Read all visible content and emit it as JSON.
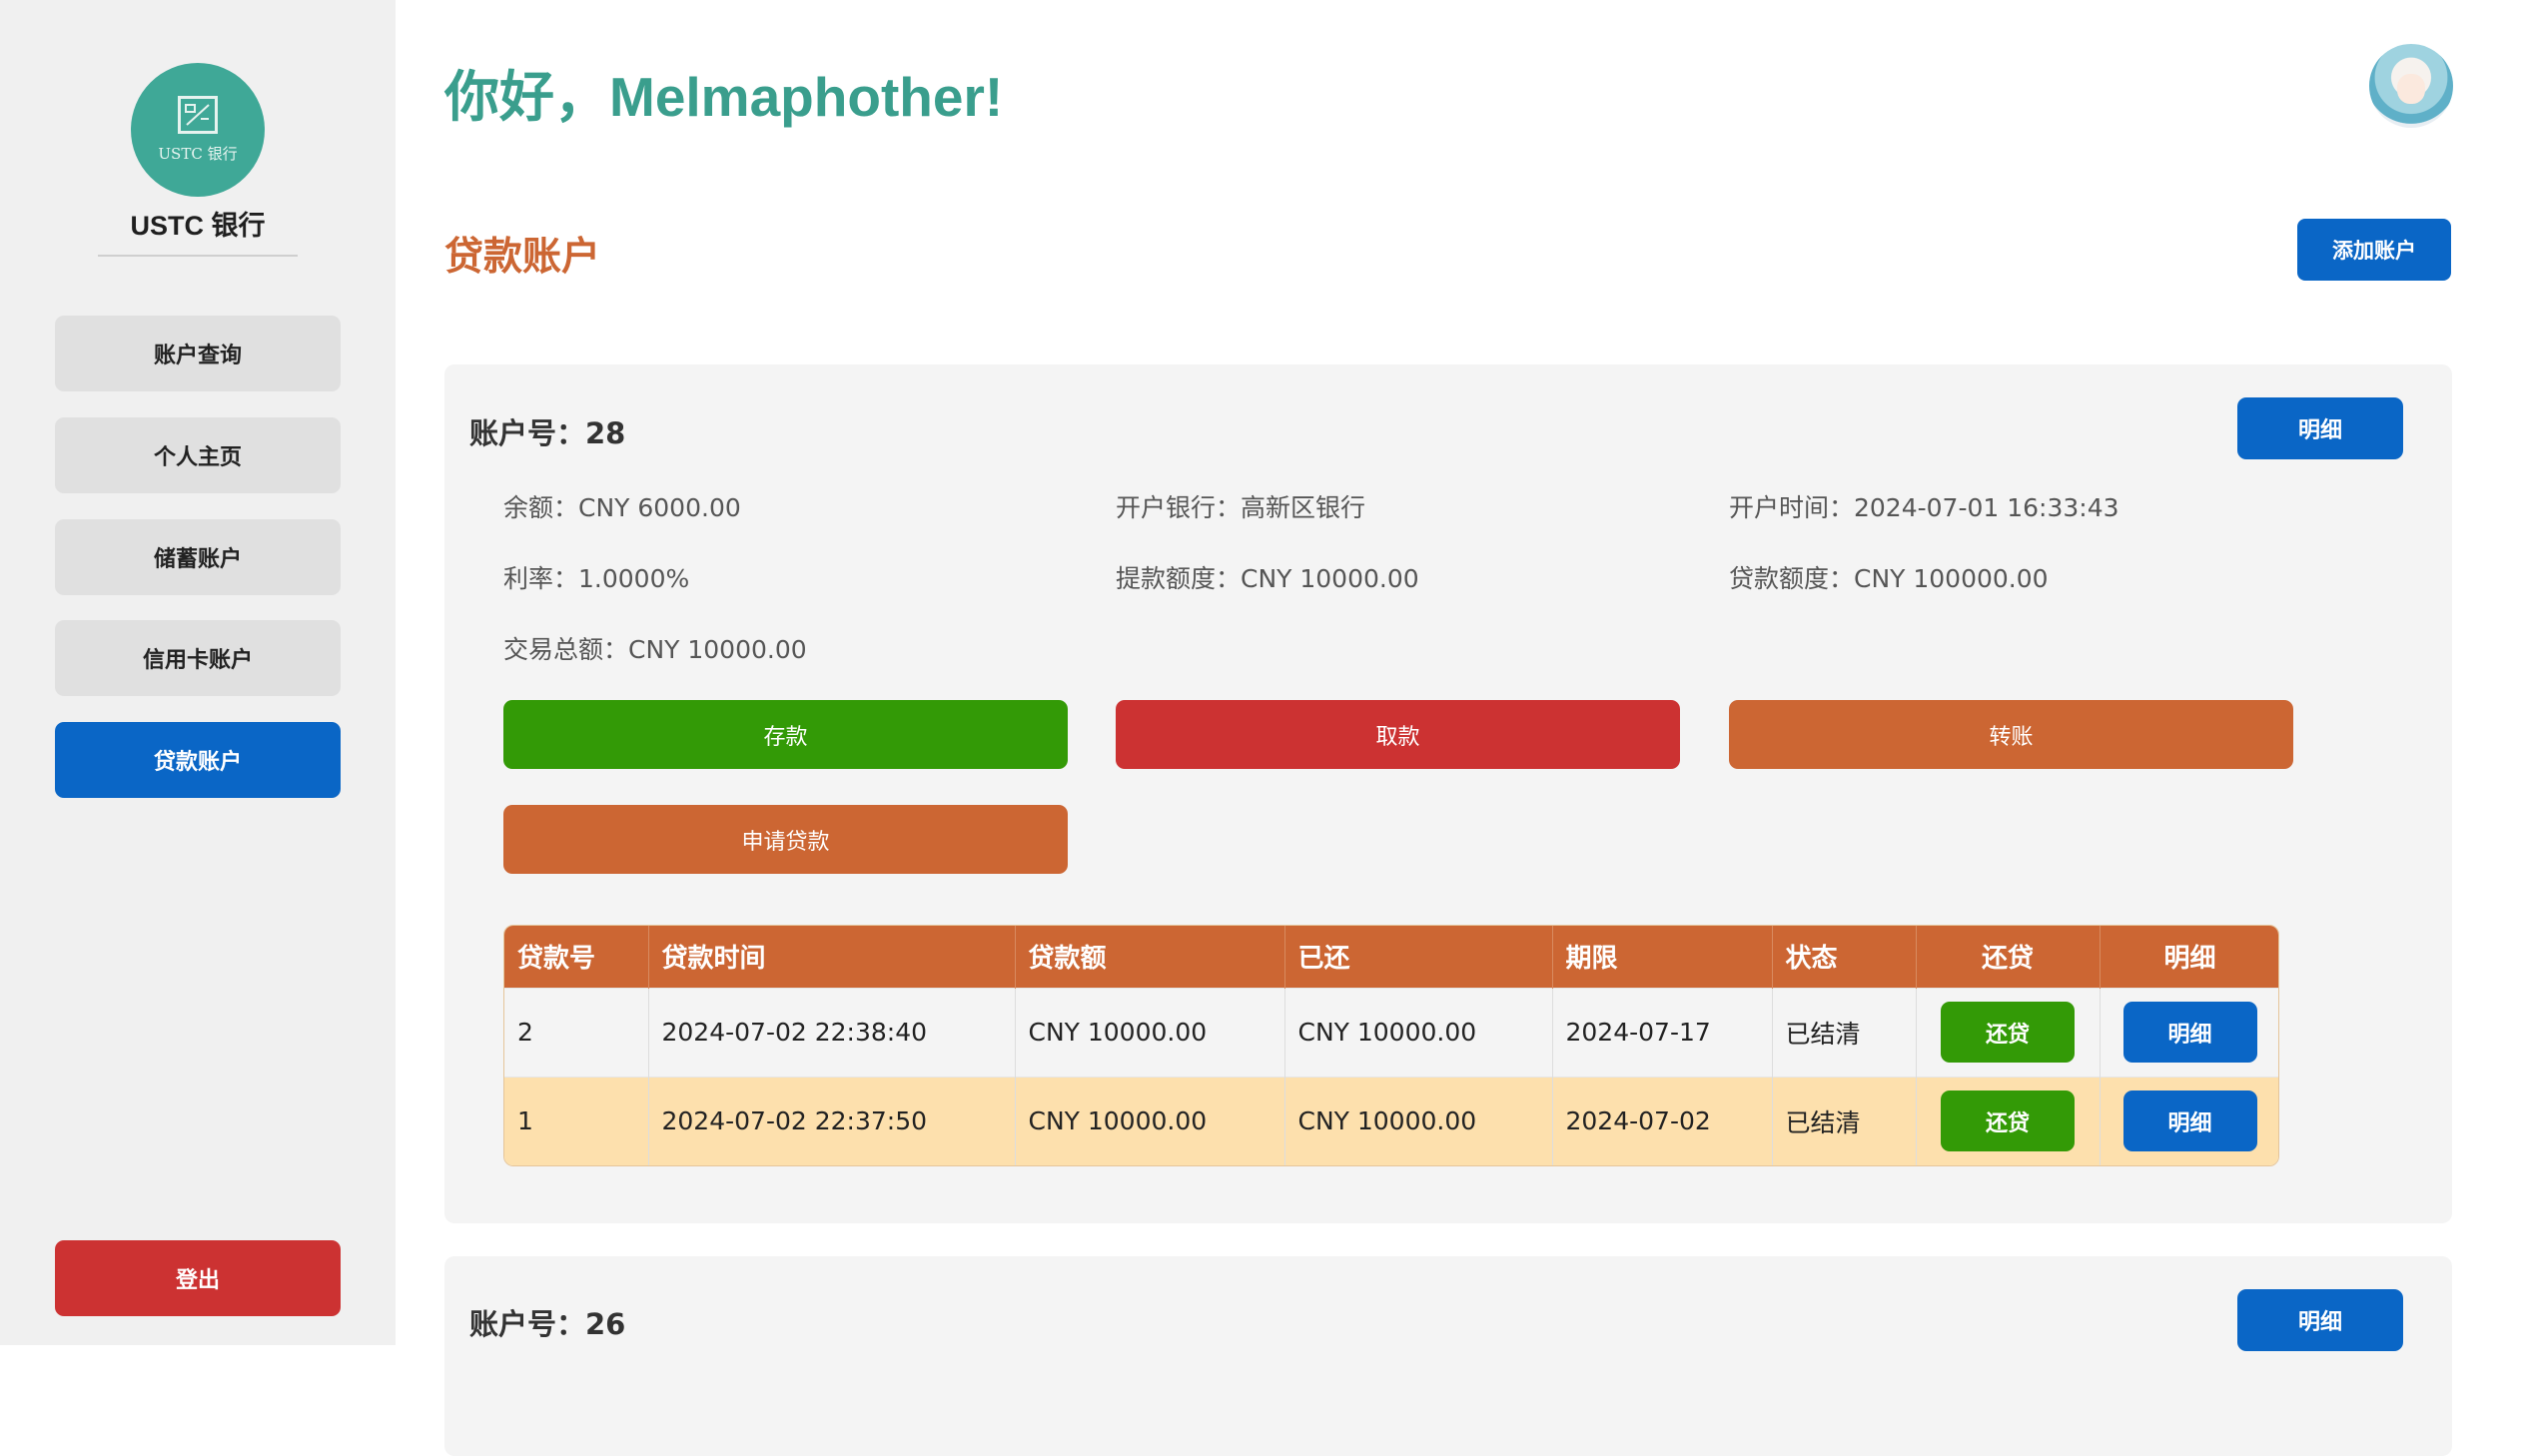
{
  "sidebar": {
    "logo_text": "USTC 银行",
    "bank_name": "USTC 银行",
    "items": [
      {
        "label": "账户查询"
      },
      {
        "label": "个人主页"
      },
      {
        "label": "储蓄账户"
      },
      {
        "label": "信用卡账户"
      },
      {
        "label": "贷款账户"
      }
    ],
    "active_item": "贷款账户",
    "logout_label": "登出"
  },
  "header": {
    "greeting": "你好，Melmaphother!"
  },
  "page": {
    "section_title": "贷款账户",
    "add_account_label": "添加账户"
  },
  "accounts": [
    {
      "account_no": "账户号：28",
      "detail_label": "明细",
      "info": {
        "balance": "余额：CNY 6000.00",
        "bank": "开户银行：高新区银行",
        "open_time": "开户时间：2024-07-01 16:33:43",
        "rate": "利率：1.0000%",
        "withdraw_limit": "提款额度：CNY 10000.00",
        "loan_limit": "贷款额度：CNY 100000.00",
        "total": "交易总额：CNY 10000.00"
      },
      "actions": {
        "deposit": "存款",
        "withdraw": "取款",
        "transfer": "转账",
        "apply_loan": "申请贷款"
      },
      "loan_table": {
        "headers": [
          "贷款号",
          "贷款时间",
          "贷款额",
          "已还",
          "期限",
          "状态",
          "还贷",
          "明细"
        ],
        "rows": [
          {
            "id": "2",
            "time": "2024-07-02 22:38:40",
            "amount": "CNY 10000.00",
            "repaid": "CNY 10000.00",
            "due": "2024-07-17",
            "status": "已结清",
            "repay_label": "还贷",
            "detail_label": "明细"
          },
          {
            "id": "1",
            "time": "2024-07-02 22:37:50",
            "amount": "CNY 10000.00",
            "repaid": "CNY 10000.00",
            "due": "2024-07-02",
            "status": "已结清",
            "repay_label": "还贷",
            "detail_label": "明细"
          }
        ]
      }
    },
    {
      "account_no": "账户号：26",
      "detail_label": "明细"
    }
  ],
  "colors": {
    "primary": "#0a66c6",
    "accent_orange": "#cc6633",
    "success": "#339a06",
    "danger": "#cc3232",
    "greeting": "#3a9e8d"
  }
}
